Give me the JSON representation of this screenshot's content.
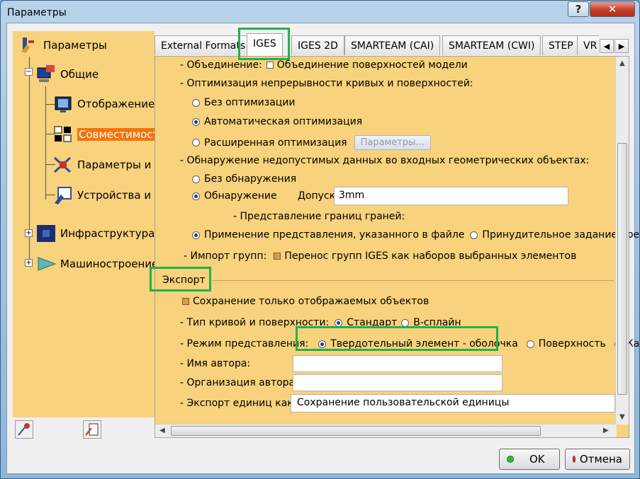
{
  "window": {
    "title": "Параметры",
    "help_label": "?",
    "close_label": "✕"
  },
  "tree": {
    "items": [
      {
        "label": "Параметры",
        "icon": "options-root-icon"
      },
      {
        "label": "Общие",
        "icon": "general-icon"
      },
      {
        "label": "Отображение",
        "icon": "display-icon"
      },
      {
        "label": "Совместимость",
        "icon": "compatibility-icon"
      },
      {
        "label": "Параметры и",
        "icon": "parameters-icon"
      },
      {
        "label": "Устройства и",
        "icon": "devices-icon"
      },
      {
        "label": "Инфраструктура",
        "icon": "infrastructure-icon"
      },
      {
        "label": "Машиностроение",
        "icon": "mechanical-icon"
      }
    ]
  },
  "tabs": [
    "External Formats",
    "IGES",
    "IGES 2D",
    "SMARTEAM (CAI)",
    "SMARTEAM (CWI)",
    "STEP",
    "VR"
  ],
  "active_tab": "IGES",
  "content": {
    "merge_label": "- Объединение:",
    "merge_checkbox": "Объединение поверхностей модели",
    "optimization_title": "- Оптимизация непрерывности кривых и поверхностей:",
    "opt_none": "Без оптимизации",
    "opt_auto": "Автоматическая оптимизация",
    "opt_ext": "Расширенная оптимизация",
    "opt_params_btn": "Параметры...",
    "detect_title": "- Обнаружение недопустимых данных во входных геометрических объектах:",
    "detect_none": "Без обнаружения",
    "detect_on": "Обнаружение",
    "tolerance_label": "Допуск:",
    "tolerance_value": "3mm",
    "face_repr_title": "- Представление границ граней:",
    "face_repr_file": "Применение представления, указанного в файле",
    "face_repr_forced": "Принудительное задание пре",
    "group_import_label": "- Импорт групп:",
    "group_import_checkbox": "Перенос групп IGES как наборов выбранных элементов",
    "export_section": "Экспорт",
    "save_visible": "Сохранение только отображаемых объектов",
    "curve_type_label": "- Тип кривой и поверхности:",
    "curve_standard": "Стандарт",
    "curve_bspline": "В-сплайн",
    "repr_mode_label": "- Режим представления:",
    "repr_solid": "Твердотельный элемент - оболочка",
    "repr_surface": "Поверхность",
    "repr_other": "Ка",
    "author_label": "- Имя автора:",
    "author_value": "",
    "org_label": "- Организация автора:",
    "org_value": "",
    "units_label": "- Экспорт единиц как:",
    "units_value": "Сохранение пользовательской единицы"
  },
  "footer": {
    "ok_label": "OK",
    "cancel_label": "Отмена"
  },
  "colors": {
    "panel_bg": "#f8d27c",
    "selection": "#f4730c",
    "highlight": "#22b14c"
  }
}
